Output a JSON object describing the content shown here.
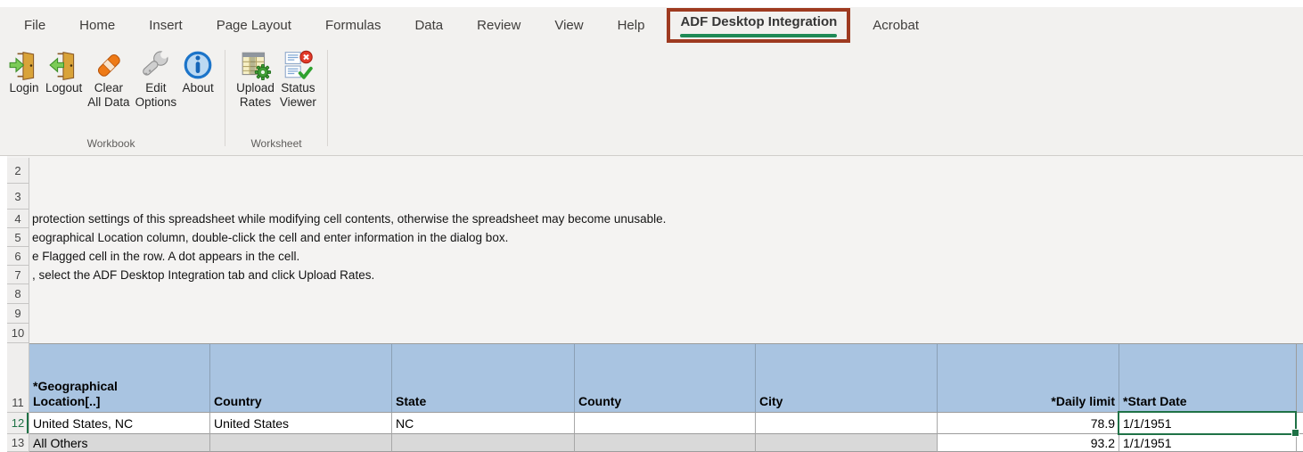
{
  "ribbon": {
    "tabs": [
      "File",
      "Home",
      "Insert",
      "Page Layout",
      "Formulas",
      "Data",
      "Review",
      "View",
      "Help",
      "ADF Desktop Integration",
      "Acrobat"
    ],
    "active_tab": "ADF Desktop Integration",
    "groups": [
      {
        "label": "Workbook",
        "buttons": [
          {
            "line1": "Login",
            "icon": "login-door-icon"
          },
          {
            "line1": "Logout",
            "icon": "logout-door-icon"
          },
          {
            "line1": "Clear",
            "line2": "All Data",
            "icon": "eraser-icon"
          },
          {
            "line1": "Edit",
            "line2": "Options",
            "icon": "wrench-icon"
          },
          {
            "line1": "About",
            "icon": "info-icon"
          }
        ]
      },
      {
        "label": "Worksheet",
        "buttons": [
          {
            "line1": "Upload",
            "line2": "Rates",
            "icon": "upload-rates-icon"
          },
          {
            "line1": "Status",
            "line2": "Viewer",
            "icon": "status-viewer-icon"
          }
        ]
      }
    ]
  },
  "colors": {
    "annotation_box": "#9e3a20",
    "active_tab_underline": "#1f8a56",
    "table_header_fill": "#a9c4e1",
    "selected_cell_border": "#1f7246",
    "alternate_row_fill": "#d9d9d9"
  },
  "sheet": {
    "row_numbers": [
      "2",
      "3",
      "4",
      "5",
      "6",
      "7",
      "8",
      "9",
      "10"
    ],
    "instructions": {
      "r4": "protection settings of this spreadsheet while modifying cell contents, otherwise the spreadsheet may become unusable.",
      "r5": "eographical Location column, double-click the cell and enter information in the dialog box.",
      "r6": "e Flagged cell in the row. A dot appears in the cell.",
      "r7": ", select the ADF Desktop Integration tab and click Upload Rates."
    },
    "table": {
      "header_row_num": "11",
      "headers": [
        "*Geographical\nLocation[..]",
        "Country",
        "State",
        "County",
        "City",
        "*Daily limit",
        "*Start Date"
      ],
      "rows": [
        {
          "num": "12",
          "cells": [
            "United States, NC",
            "United States",
            "NC",
            "",
            "",
            "78.9",
            "1/1/1951"
          ]
        },
        {
          "num": "13",
          "cells": [
            "All Others",
            "",
            "",
            "",
            "",
            "93.2",
            "1/1/1951"
          ]
        }
      ],
      "selected_cell": {
        "row": "12",
        "column": "*Start Date",
        "value": "1/1/1951"
      }
    }
  }
}
